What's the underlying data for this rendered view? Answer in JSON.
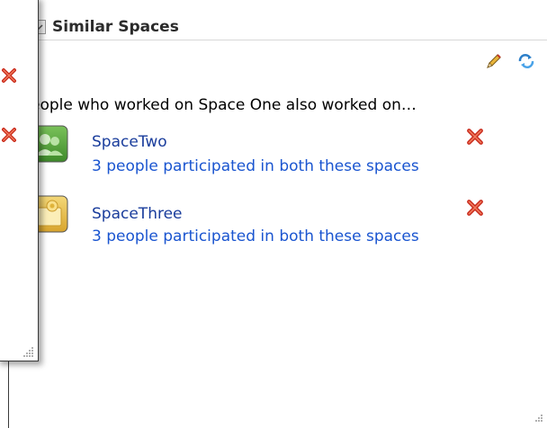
{
  "portlet": {
    "title": "Similar Spaces",
    "intro_text": "eople who worked on Space One also worked on…",
    "actions": {
      "edit_icon": "pencil-icon",
      "refresh_icon": "refresh-icon"
    }
  },
  "spaces": [
    {
      "name": "SpaceTwo",
      "description": "3 people participated in both these spaces",
      "icon": "people-group-icon",
      "remove_icon": "remove-x-icon"
    },
    {
      "name": "SpaceThree",
      "description": "3 people participated in both these spaces",
      "icon": "folder-space-icon",
      "remove_icon": "remove-x-icon"
    }
  ],
  "left_panel": {
    "remove_icons": [
      "remove-x-icon",
      "remove-x-icon"
    ]
  },
  "colors": {
    "link": "#1a55d0",
    "name_link": "#1a3d9c",
    "remove": "#cc2a1a",
    "panel_border": "#3a3a3a"
  }
}
